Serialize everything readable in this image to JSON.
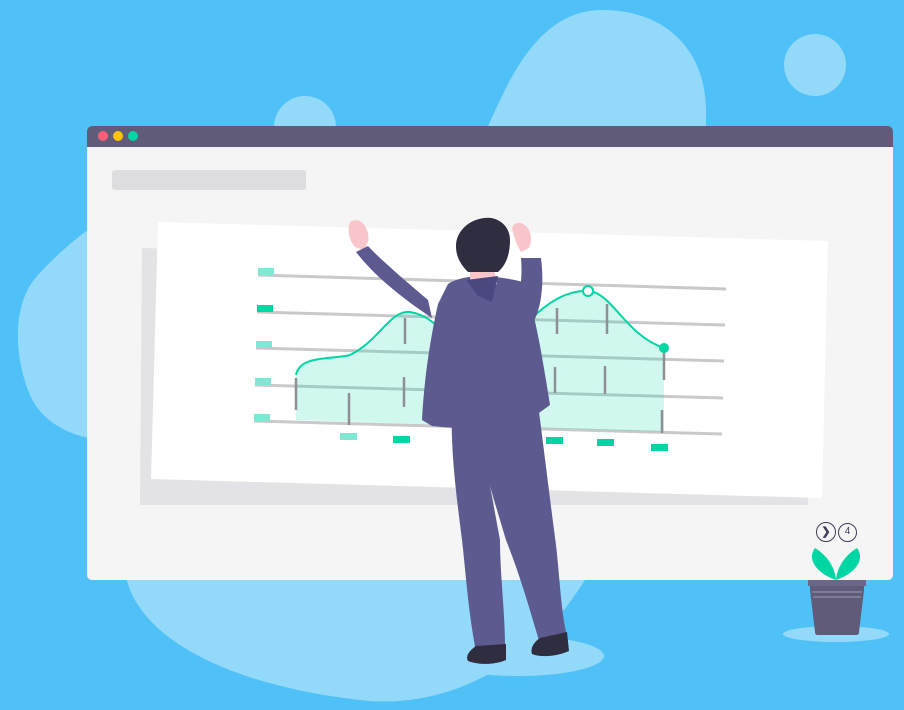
{
  "colors": {
    "background": "#4fc1f6",
    "blob": "#93d9f9",
    "window_bar": "#5f5b79",
    "window_body": "#f5f5f5",
    "placeholder_bar": "#dddde0",
    "chart_card": "#ffffff",
    "accent": "#00d6a4",
    "accent_light": "#7fe8d2",
    "person_suit": "#5d5a8f",
    "traffic_red": "#ff5f76",
    "traffic_yellow": "#ffc10a",
    "traffic_green": "#00d6a4"
  },
  "icons": {
    "next": "chevron-right-icon"
  },
  "pager": {
    "next_glyph": "❯",
    "page_number": "4"
  },
  "chart_data": {
    "type": "area",
    "series": [
      {
        "values": [
          3.4,
          4.6,
          3.6,
          5.2,
          3.1
        ]
      }
    ],
    "grid": true
  }
}
